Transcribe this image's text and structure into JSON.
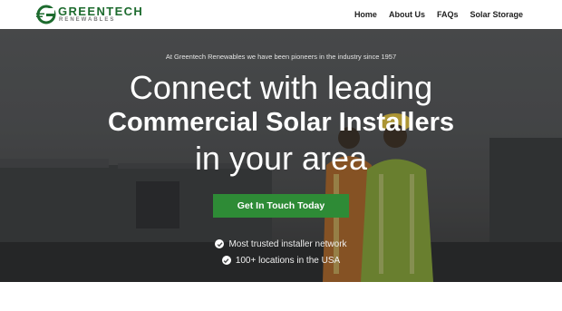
{
  "brand": {
    "name": "GREENTECH",
    "subname": "RENEWABLES",
    "logo_icon": "g-logo-icon",
    "colors": {
      "primary": "#1d6b2e",
      "cta": "#2e8b36",
      "text": "#1e1e1e"
    }
  },
  "nav": {
    "items": [
      {
        "label": "Home"
      },
      {
        "label": "About Us"
      },
      {
        "label": "FAQs"
      },
      {
        "label": "Solar Storage"
      }
    ]
  },
  "hero": {
    "tagline": "At Greentech Renewables we have been pioneers in the industry since 1957",
    "headline_line1": "Connect with leading",
    "headline_line2": "Commercial Solar Installers",
    "headline_line3": "in your area",
    "cta_label": "Get In Touch Today",
    "features": [
      {
        "text": "Most trusted installer network",
        "icon": "check-circle-icon"
      },
      {
        "text": "100+ locations in the USA",
        "icon": "check-circle-icon"
      }
    ]
  }
}
